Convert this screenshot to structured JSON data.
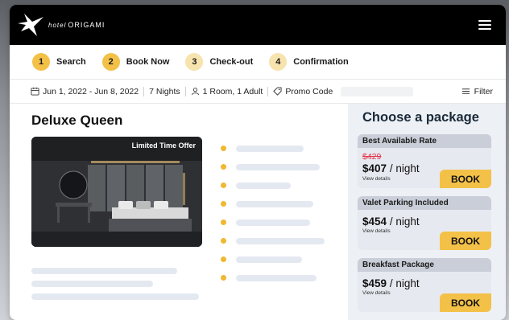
{
  "brand": {
    "logo_small": "hotel",
    "logo_name": "ORIGAMI"
  },
  "steps": [
    {
      "num": "1",
      "label": "Search"
    },
    {
      "num": "2",
      "label": "Book Now"
    },
    {
      "num": "3",
      "label": "Check-out"
    },
    {
      "num": "4",
      "label": "Confirmation"
    }
  ],
  "search": {
    "dates": "Jun 1, 2022 - Jun 8, 2022",
    "nights": "7 Nights",
    "guests": "1 Room, 1 Adult",
    "promo_label": "Promo Code",
    "promo_value": "",
    "filter_label": "Filter"
  },
  "room": {
    "title": "Deluxe Queen",
    "badge": "Limited Time Offer"
  },
  "packages": {
    "title": "Choose a package",
    "items": [
      {
        "name": "Best Available Rate",
        "old_price": "$429",
        "price": "$407",
        "unit": "/ night",
        "details": "View details",
        "book": "BOOK"
      },
      {
        "name": "Valet Parking Included",
        "old_price": "",
        "price": "$454",
        "unit": "/ night",
        "details": "View details",
        "book": "BOOK"
      },
      {
        "name": "Breakfast Package",
        "old_price": "",
        "price": "$459",
        "unit": "/ night",
        "details": "View details",
        "book": "BOOK"
      }
    ]
  },
  "colors": {
    "accent": "#f3c147",
    "accent_light": "#f7e3ad",
    "strike_price": "#e5334a",
    "topbar": "#000000",
    "panel": "#edf0f4"
  }
}
